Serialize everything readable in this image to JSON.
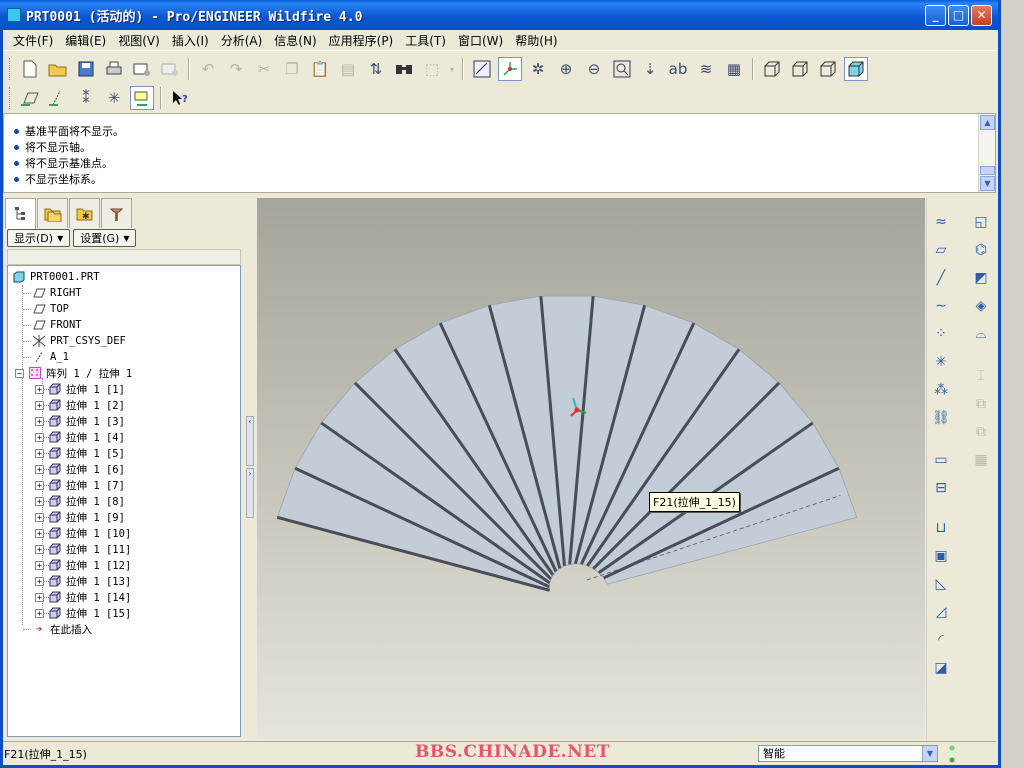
{
  "window": {
    "title": "PRT0001 (活动的) - Pro/ENGINEER Wildfire 4.0",
    "minimize_glyph": "_",
    "maximize_glyph": "□",
    "close_glyph": "✕"
  },
  "menu": [
    "文件(F)",
    "编辑(E)",
    "视图(V)",
    "插入(I)",
    "分析(A)",
    "信息(N)",
    "应用程序(P)",
    "工具(T)",
    "窗口(W)",
    "帮助(H)"
  ],
  "messages": [
    "基准平面将不显示。",
    "将不显示轴。",
    "将不显示基准点。",
    "不显示坐标系。"
  ],
  "panel": {
    "show_button": "显示(D)",
    "settings_button": "设置(G)"
  },
  "tree": {
    "root": "PRT0001.PRT",
    "datums": [
      "RIGHT",
      "TOP",
      "FRONT",
      "PRT_CSYS_DEF",
      "A_1"
    ],
    "pattern": "阵列 1 / 拉伸 1",
    "members": [
      "拉伸 1 [1]",
      "拉伸 1 [2]",
      "拉伸 1 [3]",
      "拉伸 1 [4]",
      "拉伸 1 [5]",
      "拉伸 1 [6]",
      "拉伸 1 [7]",
      "拉伸 1 [8]",
      "拉伸 1 [9]",
      "拉伸 1 [10]",
      "拉伸 1 [11]",
      "拉伸 1 [12]",
      "拉伸 1 [13]",
      "拉伸 1 [14]",
      "拉伸 1 [15]"
    ],
    "insert_here": "在此插入"
  },
  "graphics": {
    "tooltip": "F21(拉伸_1_15)",
    "fan_blades": 15,
    "colors": {
      "blade_fill": "#c2cdd8",
      "blade_edge": "#4a4d55",
      "csys_x": "#e03030",
      "csys_y": "#20c0c0",
      "csys_z": "#30a030"
    }
  },
  "status": {
    "text": "F21(拉伸_1_15)",
    "watermark": "BBS.CHINADE.NET",
    "filter_value": "智能",
    "filter_arrow": "▼"
  },
  "icons": {
    "expander_collapse": "−",
    "expander_expand": "+",
    "insert_arrow": "➔",
    "caret": "▼",
    "scroll_up": "▲",
    "scroll_down": "▼",
    "splitter_left": "‹",
    "splitter_right": "›"
  }
}
